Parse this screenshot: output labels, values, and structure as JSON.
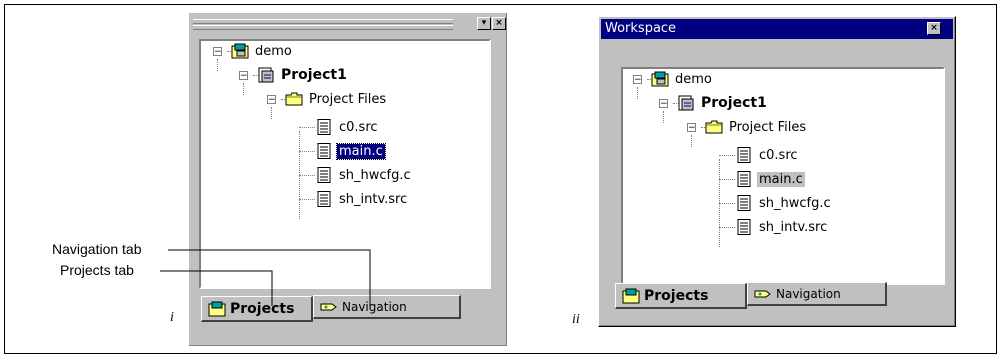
{
  "figure": {
    "label_i": "i",
    "label_ii": "ii",
    "callouts": {
      "navigation_tab": "Navigation tab",
      "projects_tab": "Projects tab"
    }
  },
  "panel_i": {
    "title_buttons": [
      "▾",
      "×"
    ],
    "tree": {
      "workspace": "demo",
      "project": "Project1",
      "folder": "Project Files",
      "files": [
        "c0.src",
        "main.c",
        "sh_hwcfg.c",
        "sh_intv.src"
      ],
      "selected_file": "main.c"
    },
    "tabs": {
      "projects": "Projects",
      "navigation": "Navigation"
    }
  },
  "panel_ii": {
    "title": "Workspace",
    "close_glyph": "×",
    "tree": {
      "workspace": "demo",
      "project": "Project1",
      "folder": "Project Files",
      "files": [
        "c0.src",
        "main.c",
        "sh_hwcfg.c",
        "sh_intv.src"
      ],
      "selected_file": "main.c"
    },
    "tabs": {
      "projects": "Projects",
      "navigation": "Navigation"
    }
  },
  "colors": {
    "selection_active": "#000080",
    "selection_inactive": "#c0c0c0",
    "titlebar": "#000080",
    "chrome": "#c0c0c0"
  },
  "icons": [
    "workspace-icon",
    "project-icon",
    "folder-icon",
    "file-icon",
    "projects-tab-icon",
    "navigation-tab-icon",
    "minimize-icon",
    "close-icon"
  ]
}
